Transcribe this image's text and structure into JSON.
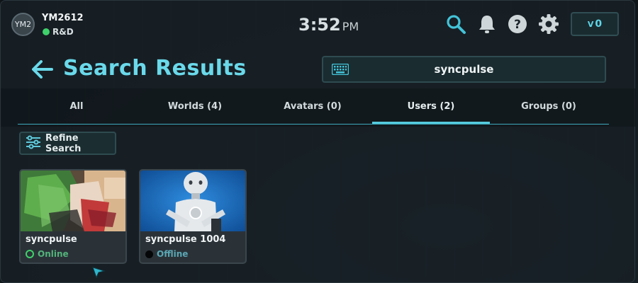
{
  "user": {
    "avatar_initials": "YM2",
    "name": "YM2612",
    "status": "R&D"
  },
  "clock": {
    "time": "3:52",
    "ampm": "PM"
  },
  "topbar_icons": [
    "search-icon",
    "bell-icon",
    "help-icon",
    "gear-icon"
  ],
  "currency": {
    "symbol": "V",
    "amount": "0"
  },
  "page": {
    "title": "Search Results"
  },
  "search": {
    "value": "syncpulse"
  },
  "tabs": [
    {
      "label": "All",
      "active": false
    },
    {
      "label": "Worlds (4)",
      "active": false
    },
    {
      "label": "Avatars (0)",
      "active": false
    },
    {
      "label": "Users (2)",
      "active": true
    },
    {
      "label": "Groups (0)",
      "active": false
    }
  ],
  "refine": {
    "label": "Refine Search"
  },
  "results": [
    {
      "name": "syncpulse",
      "status": "Online"
    },
    {
      "name": "syncpulse 1004",
      "status": "Offline"
    }
  ],
  "colors": {
    "accent": "#6ad9ea",
    "online": "#3fd16b",
    "panel": "#182026"
  }
}
